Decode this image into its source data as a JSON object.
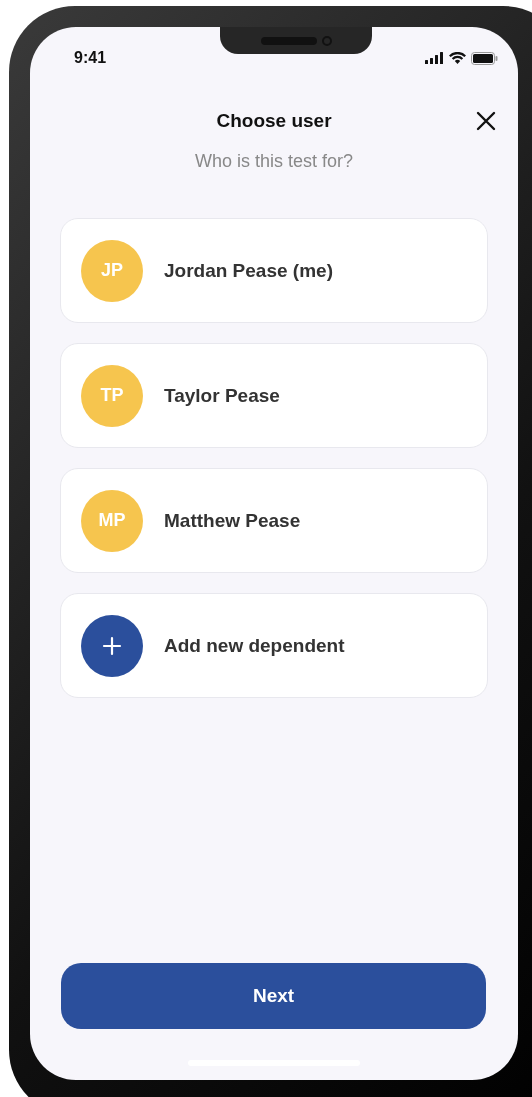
{
  "status_bar": {
    "time": "9:41"
  },
  "header": {
    "title": "Choose user",
    "subtitle": "Who is this test for?"
  },
  "users": [
    {
      "kind": "person",
      "initials": "JP",
      "name": "Jordan Pease (me)",
      "color": "#f6c54e"
    },
    {
      "kind": "person",
      "initials": "TP",
      "name": "Taylor Pease",
      "color": "#f6c54e"
    },
    {
      "kind": "person",
      "initials": "MP",
      "name": "Matthew Pease",
      "color": "#f6c54e"
    },
    {
      "kind": "add",
      "name": "Add new dependent",
      "color": "#2b4f9c"
    }
  ],
  "buttons": {
    "next": "Next"
  }
}
